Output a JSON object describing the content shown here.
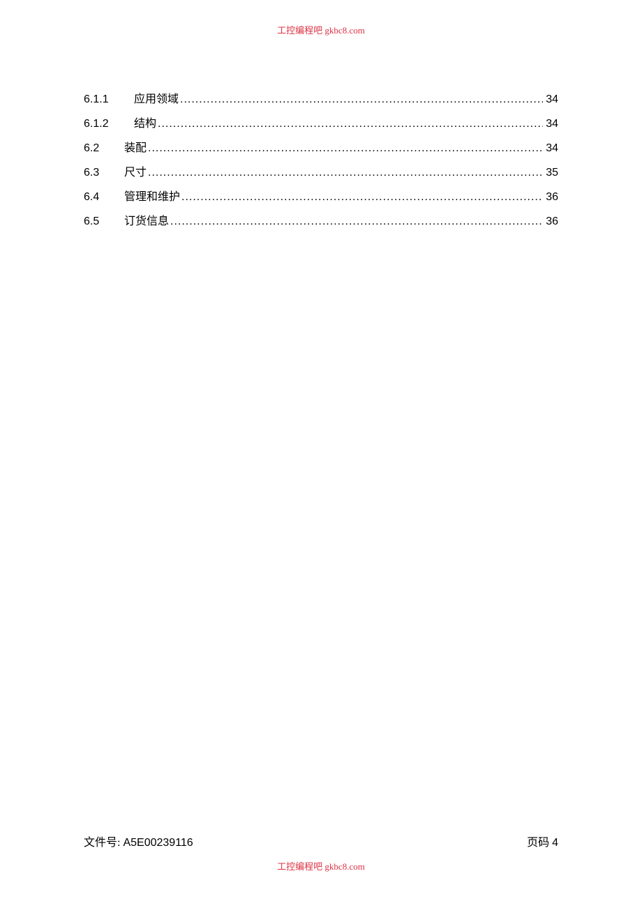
{
  "watermark": {
    "text": "工控编程吧   gkbc8.com"
  },
  "toc": {
    "entries": [
      {
        "num": "6.1.1",
        "title": "应用领域",
        "page": "34",
        "sub": true
      },
      {
        "num": "6.1.2",
        "title": "结构",
        "page": "34",
        "sub": true
      },
      {
        "num": "6.2",
        "title": "装配",
        "page": "34",
        "sub": false
      },
      {
        "num": "6.3",
        "title": "尺寸",
        "page": "35",
        "sub": false
      },
      {
        "num": "6.4",
        "title": "管理和维护",
        "page": "36",
        "sub": false
      },
      {
        "num": "6.5",
        "title": "订货信息",
        "page": "36",
        "sub": false
      }
    ]
  },
  "footer": {
    "file_label": "文件号: ",
    "file_number": "A5E00239116",
    "page_label": "页码 ",
    "page_number": "4"
  }
}
